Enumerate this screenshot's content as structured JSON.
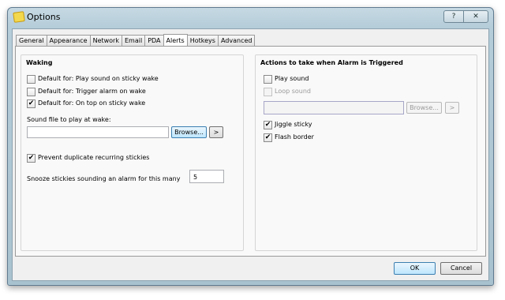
{
  "window": {
    "title": "Options",
    "help_label": "?",
    "close_label": "✕"
  },
  "tabs": [
    {
      "label": "General"
    },
    {
      "label": "Appearance"
    },
    {
      "label": "Network"
    },
    {
      "label": "Email"
    },
    {
      "label": "PDA"
    },
    {
      "label": "Alerts",
      "active": true
    },
    {
      "label": "Hotkeys"
    },
    {
      "label": "Advanced"
    }
  ],
  "waking": {
    "title": "Waking",
    "options": [
      {
        "label": "Default for: Play sound on sticky wake",
        "checked": false
      },
      {
        "label": "Default for: Trigger alarm on wake",
        "checked": false
      },
      {
        "label": "Default for: On top on sticky wake",
        "checked": true
      }
    ],
    "sound_label": "Sound file to play at wake:",
    "sound_value": "",
    "browse_label": "Browse...",
    "play_label": ">",
    "prevent_label": "Prevent duplicate recurring stickies",
    "prevent_checked": true,
    "snooze_label": "Snooze stickies sounding an alarm for this many",
    "snooze_value": "5"
  },
  "actions": {
    "title": "Actions to take when Alarm is Triggered",
    "play_sound_label": "Play sound",
    "play_sound_checked": false,
    "loop_sound_label": "Loop sound",
    "loop_sound_checked": false,
    "sound_value": "",
    "browse_label": "Browse...",
    "play_label": ">",
    "jiggle_label": "Jiggle sticky",
    "jiggle_checked": true,
    "flash_label": "Flash border",
    "flash_checked": true
  },
  "footer": {
    "ok_label": "OK",
    "cancel_label": "Cancel"
  },
  "check_mark": "✔"
}
